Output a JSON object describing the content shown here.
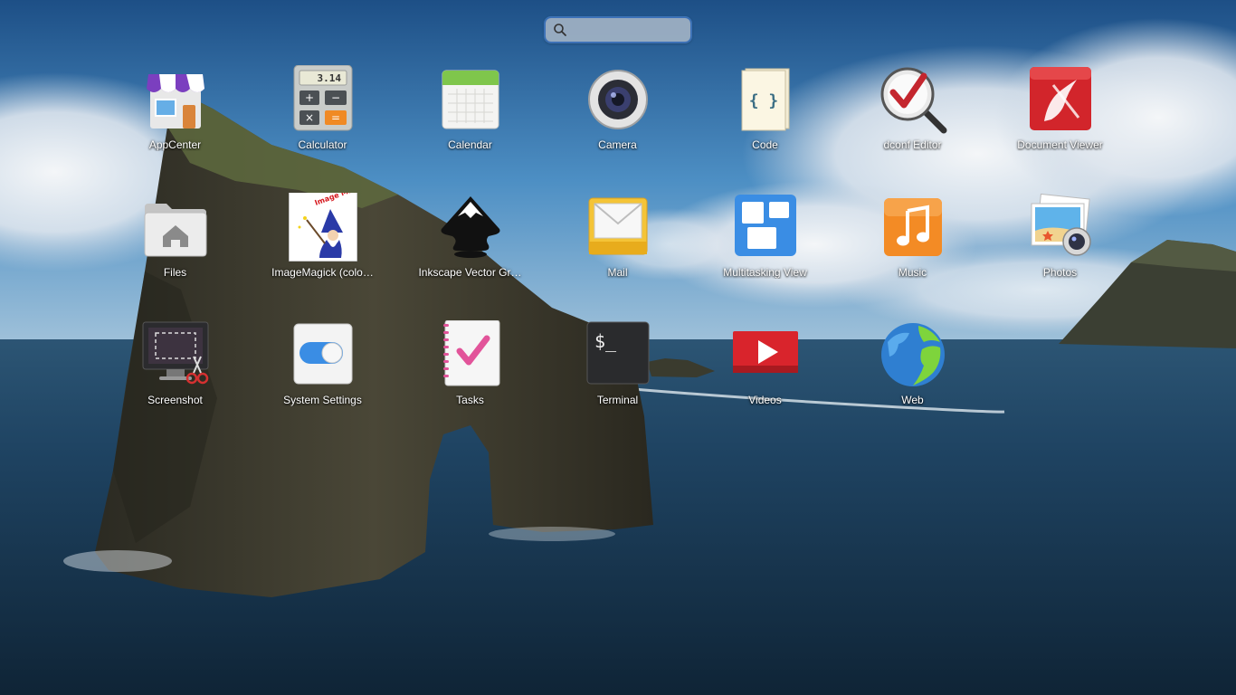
{
  "search": {
    "placeholder": "",
    "value": ""
  },
  "apps": [
    {
      "label": "AppCenter",
      "icon": "appcenter-icon"
    },
    {
      "label": "Calculator",
      "icon": "calculator-icon",
      "display": "3.14"
    },
    {
      "label": "Calendar",
      "icon": "calendar-icon"
    },
    {
      "label": "Camera",
      "icon": "camera-icon"
    },
    {
      "label": "Code",
      "icon": "code-icon",
      "glyph": "{ }"
    },
    {
      "label": "dconf Editor",
      "icon": "dconf-editor-icon"
    },
    {
      "label": "Document Viewer",
      "icon": "document-viewer-icon"
    },
    {
      "label": "Files",
      "icon": "files-icon"
    },
    {
      "label": "ImageMagick (colo…",
      "icon": "imagemagick-icon",
      "logo_text": "Image Magick"
    },
    {
      "label": "Inkscape Vector Gr…",
      "icon": "inkscape-icon"
    },
    {
      "label": "Mail",
      "icon": "mail-icon"
    },
    {
      "label": "Multitasking View",
      "icon": "multitasking-view-icon"
    },
    {
      "label": "Music",
      "icon": "music-icon"
    },
    {
      "label": "Photos",
      "icon": "photos-icon"
    },
    {
      "label": "Screenshot",
      "icon": "screenshot-icon"
    },
    {
      "label": "System Settings",
      "icon": "system-settings-icon"
    },
    {
      "label": "Tasks",
      "icon": "tasks-icon"
    },
    {
      "label": "Terminal",
      "icon": "terminal-icon",
      "prompt": "$_"
    },
    {
      "label": "Videos",
      "icon": "videos-icon"
    },
    {
      "label": "Web",
      "icon": "web-icon"
    }
  ],
  "colors": {
    "accent": "#3a6fb8",
    "sky": "#2f6fa8",
    "sea": "#1a3c5a"
  }
}
